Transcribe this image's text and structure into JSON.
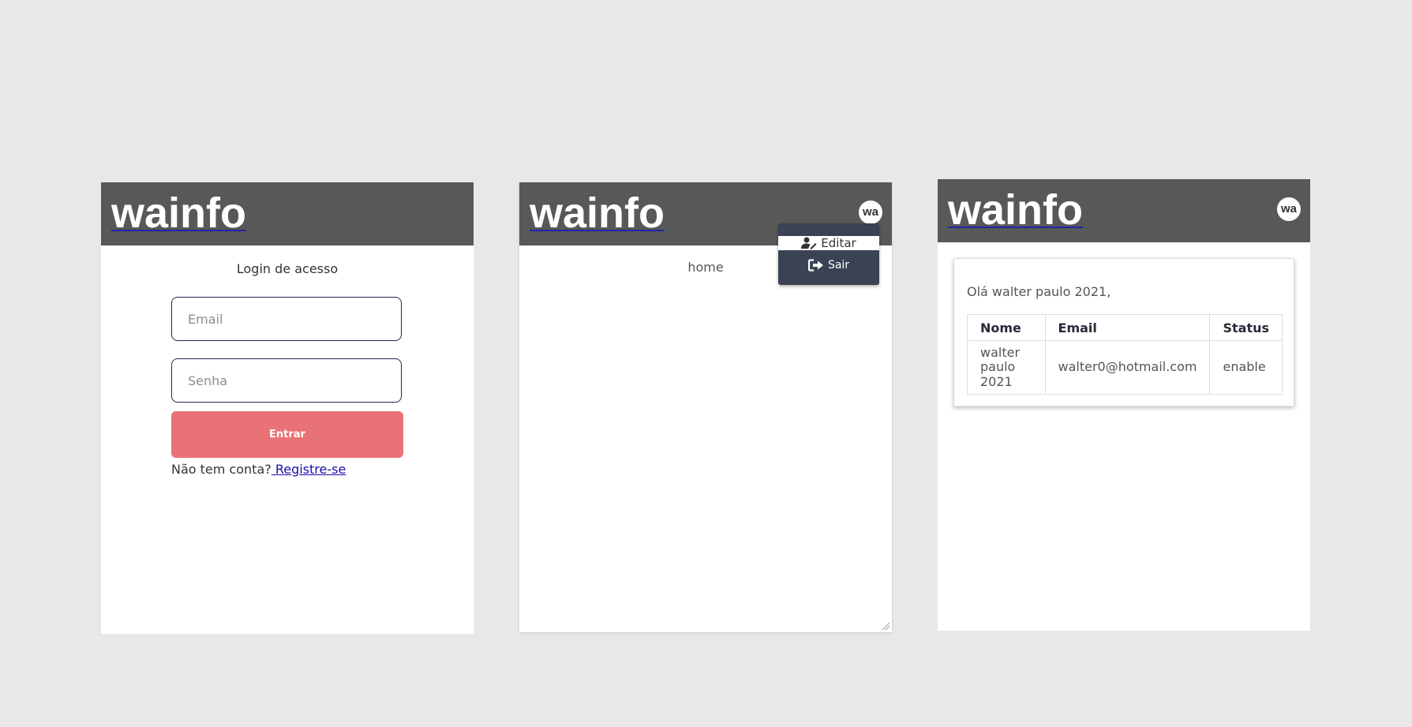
{
  "brand": "wainfo",
  "avatar_initials": "wa",
  "login": {
    "title": "Login de acesso",
    "email_placeholder": "Email",
    "senha_placeholder": "Senha",
    "submit_label": "Entrar",
    "no_account_text": "Não tem conta?",
    "register_link": " Registre-se"
  },
  "home": {
    "text": "home",
    "menu": [
      {
        "label": "Editar",
        "icon": "user-edit-icon"
      },
      {
        "label": "Sair",
        "icon": "sign-out-icon"
      }
    ]
  },
  "profile": {
    "greeting": "Olá walter paulo 2021,",
    "table": {
      "headers": [
        "Nome",
        "Email",
        "Status"
      ],
      "rows": [
        [
          "walter paulo 2021",
          "walter0@hotmail.com",
          "enable"
        ]
      ]
    }
  },
  "colors": {
    "header_bg": "#585858",
    "button_bg": "#e87276",
    "menu_bg": "#3a4253",
    "link": "#1a0dab"
  }
}
